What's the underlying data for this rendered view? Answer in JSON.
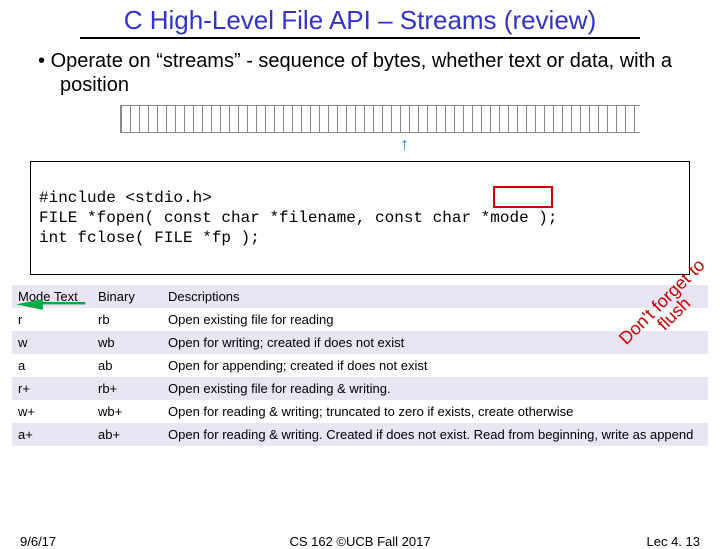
{
  "title": "C High-Level File API – Streams (review)",
  "bullet": "Operate on “streams” - sequence of bytes, whether text or data, with a position",
  "code": {
    "l1": "#include <stdio.h>",
    "l2": "FILE *fopen( const char *filename, const char *mode );",
    "l3": "int fclose( FILE *fp );"
  },
  "table": {
    "headers": {
      "c0": "Mode Text",
      "c1": "Binary",
      "c2": "Descriptions"
    },
    "rows": [
      {
        "c0": "r",
        "c1": "rb",
        "c2": "Open existing file for reading"
      },
      {
        "c0": "w",
        "c1": "wb",
        "c2": "Open for writing; created if does not exist"
      },
      {
        "c0": "a",
        "c1": "ab",
        "c2": "Open for appending; created if does not exist"
      },
      {
        "c0": "r+",
        "c1": "rb+",
        "c2": "Open existing file for reading & writing."
      },
      {
        "c0": "w+",
        "c1": "wb+",
        "c2": "Open for reading & writing; truncated to zero if exists, create otherwise"
      },
      {
        "c0": "a+",
        "c1": "ab+",
        "c2": "Open for reading & writing. Created if does not exist. Read from beginning, write as append"
      }
    ]
  },
  "callout": {
    "line1": "Don't forget to",
    "line2": "flush"
  },
  "footer": {
    "date": "9/6/17",
    "course": "CS 162 ©UCB Fall 2017",
    "lec": "Lec 4. 13"
  }
}
